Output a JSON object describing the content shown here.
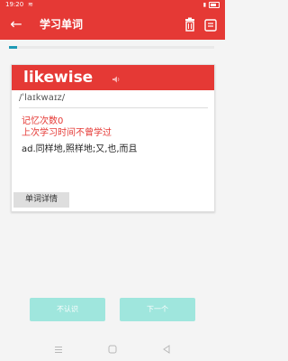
{
  "status_bar": {
    "time": "19:20",
    "wifi": "≋"
  },
  "toolbar": {
    "title": "学习单词",
    "back_icon": "arrow-left-icon",
    "delete_icon": "trash-icon",
    "menu_icon": "menu-icon"
  },
  "progress": {
    "fraction": 0.04
  },
  "word_card": {
    "word": "likewise",
    "phonetic": "/ˈlaɪkwaɪz/",
    "memory_count": "记忆次数0",
    "last_study": "上次学习时间不曾学过",
    "meaning": "ad.同样地,照样地;又,也,而且",
    "detail_button": "单词详情",
    "speaker_icon": "speaker-icon"
  },
  "actions": {
    "unknown_button": "不认识",
    "next_button": "下一个"
  },
  "colors": {
    "primary": "#e53935",
    "accent": "#1e9ab5",
    "button_bg": "#9fe6dd"
  }
}
